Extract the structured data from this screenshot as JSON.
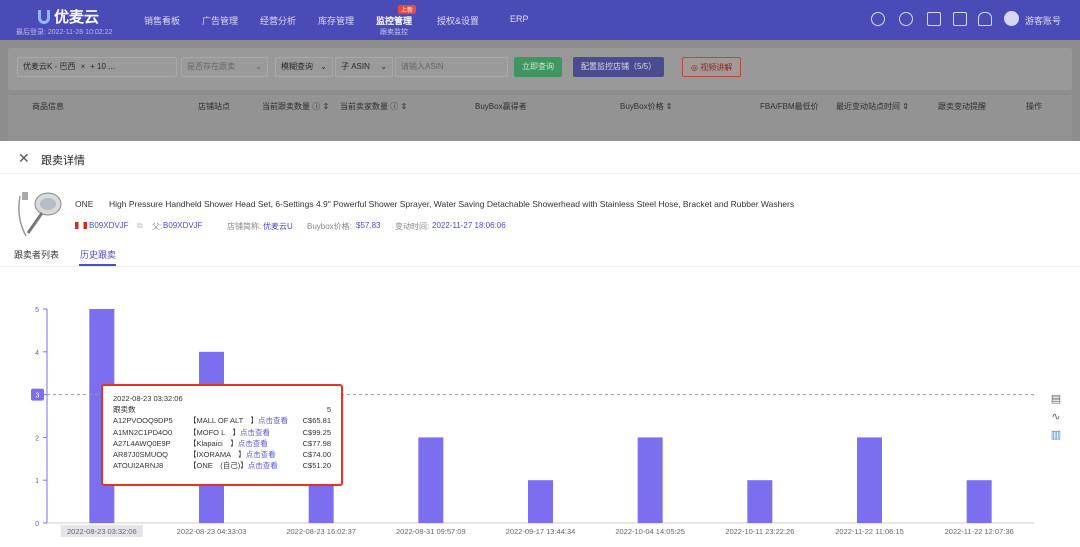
{
  "topbar": {
    "logo": "优麦云",
    "login_info": "最后登录: 2022-11-28 10:02:22",
    "nav": [
      "销售看板",
      "广告管理",
      "经营分析",
      "库存管理",
      "监控管理",
      "授权&设置",
      "ERP"
    ],
    "active_sub": "跟卖监控",
    "badge": "上新",
    "user": "游客账号",
    "icons": [
      "headset-icon",
      "help-icon",
      "message-icon",
      "cart-icon",
      "bell-icon",
      "avatar-icon"
    ]
  },
  "filters": {
    "shop": "优麦云K - 巴西",
    "shop_more": "+ 10 ...",
    "stock_placeholder": "是否存在跟卖",
    "fuzzy": "模糊查询",
    "asin_type": "子 ASIN",
    "asin_placeholder": "请输入ASIN",
    "query_button": "立即查询",
    "config_button": "配置监控店铺（5/5）",
    "video_button": "◎ 视频讲解"
  },
  "table_headers": [
    "商品信息",
    "店铺站点",
    "当前跟卖数量 ⓘ ⇕",
    "当前卖家数量 ⓘ ⇕",
    "BuyBox赢得者",
    "BuyBox价格 ⇕",
    "FBA/FBM最低价",
    "最近变动站点时间 ⇕",
    "跟卖变动提醒",
    "操作"
  ],
  "panel": {
    "title": "跟卖详情",
    "brand": "ONE",
    "product_title": "High Pressure Handheld Shower Head Set, 6-Settings 4.9\" Powerful Shower Sprayer, Water Saving Detachable Showerhead with Stainless Steel Hose, Bracket and Rubber Washers",
    "asin": "B09XDVJF",
    "parent_label": "父:",
    "parent_asin": "B09XDVJF",
    "shop_label": "店铺简称:",
    "shop_name": "优麦云U",
    "buybox_label": "Buybox价格:",
    "buybox_price": "$57.83",
    "change_label": "变动时间:",
    "change_time": "2022-11-27 18:06:06",
    "tabs": [
      "跟卖者列表",
      "历史跟卖"
    ],
    "active_tab": 1
  },
  "chart_data": {
    "type": "bar",
    "categories": [
      "2022-08-23 03:32:06",
      "2022-08-23 04:33:03",
      "2022-08-23 16:02:37",
      "2022-08-31 09:57:09",
      "2022-09-17 13:44:34",
      "2022-10-04 14:05:25",
      "2022-10-11 23:22:26",
      "2022-11-22 11:06:15",
      "2022-11-22 12:07:36"
    ],
    "values": [
      5,
      4,
      1,
      2,
      1,
      2,
      1,
      2,
      1
    ],
    "y_ticks": [
      0,
      1,
      2,
      3,
      4,
      5
    ],
    "ylim": [
      0,
      5
    ],
    "average_line": 3,
    "color": "#7b6ff0",
    "side_icons": [
      "data-view-icon",
      "line-chart-icon",
      "bar-chart-icon"
    ]
  },
  "tooltip": {
    "time": "2022-08-23 03:32:06",
    "count_label": "跟卖数",
    "count": "5",
    "rows": [
      {
        "seller_id": "A12PVOOQ9DP5",
        "name": "【MALL OF ALT　】",
        "link": "点击查看",
        "price": "C$65.81"
      },
      {
        "seller_id": "A1MN2C1PD4O0",
        "name": "【MOFO L　】",
        "link": "点击查看",
        "price": "C$99.25"
      },
      {
        "seller_id": "A27L4AWQ0E9P",
        "name": "【Klapaici　】",
        "link": "点击查看",
        "price": "C$77.98"
      },
      {
        "seller_id": "AR87J0SMUOQ",
        "name": "【IXORAMA　】",
        "link": "点击查看",
        "price": "C$74.00"
      },
      {
        "seller_id": "ATOUI2ARNJ8",
        "name": "【ONE　(自己)】",
        "link": "点击查看",
        "price": "C$51.20"
      }
    ]
  }
}
